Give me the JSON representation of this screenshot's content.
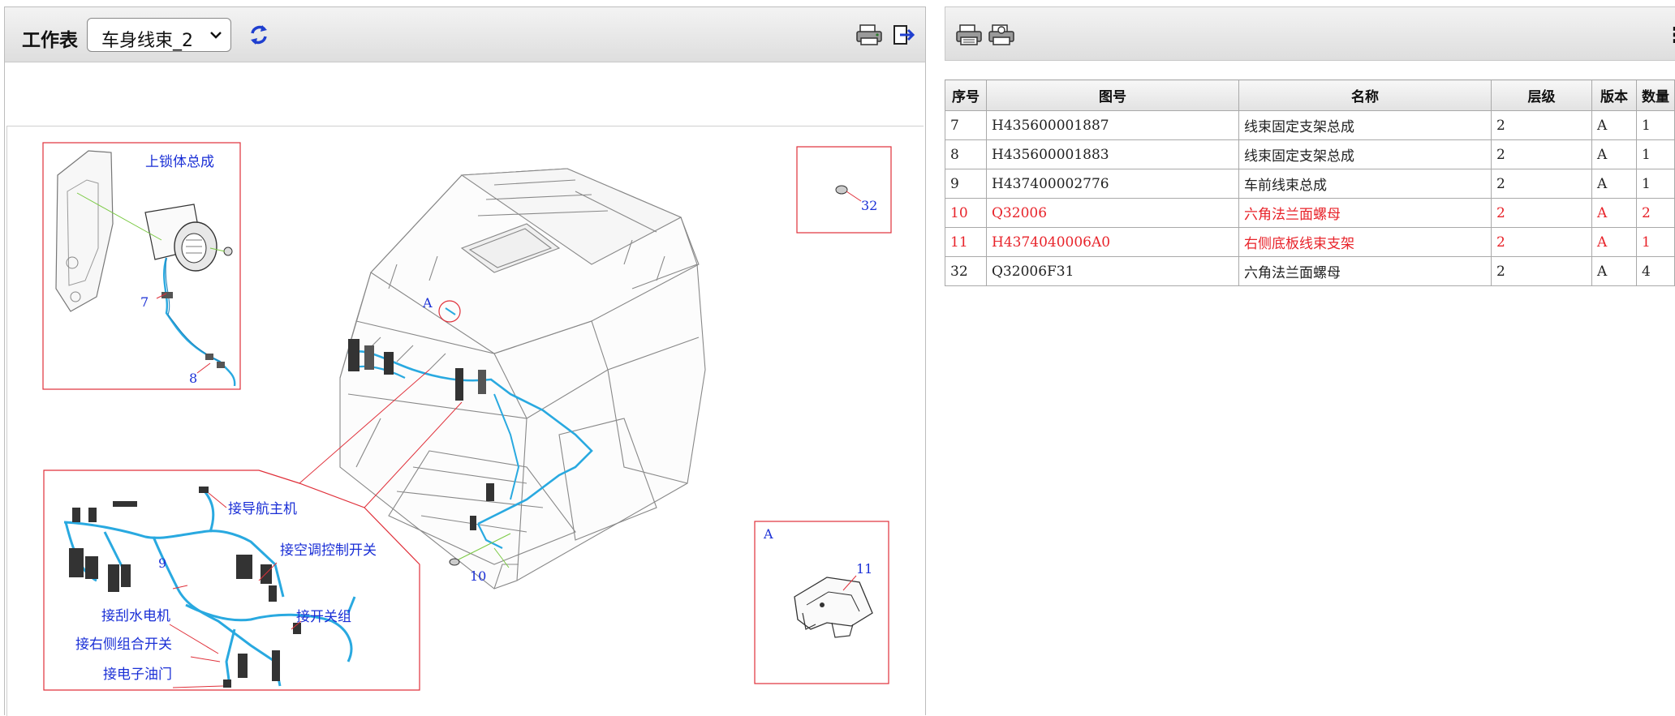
{
  "toolbar": {
    "worksheet_label": "工作表",
    "worksheet_selected": "车身线束_2"
  },
  "drawing": {
    "callouts": {
      "upper_lock": "上锁体总成",
      "nav": "接导航主机",
      "ac_switch": "接空调控制开关",
      "switch_group": "接开关组",
      "wiper": "接刮水电机",
      "right_combo": "接右侧组合开关",
      "throttle": "接电子油门"
    },
    "numbers": {
      "n7": "7",
      "n8": "8",
      "n9": "9",
      "n10": "10",
      "n11": "11",
      "n32": "32",
      "viewA_label": "A",
      "detailA_label": "A"
    }
  },
  "table": {
    "headers": {
      "seq": "序号",
      "part_no": "图号",
      "name": "名称",
      "level": "层级",
      "version": "版本",
      "qty": "数量"
    },
    "rows": [
      {
        "seq": "7",
        "part_no": "H435600001887",
        "name": "线束固定支架总成",
        "level": "2",
        "version": "A",
        "qty": "1",
        "highlight": false
      },
      {
        "seq": "8",
        "part_no": "H435600001883",
        "name": "线束固定支架总成",
        "level": "2",
        "version": "A",
        "qty": "1",
        "highlight": false
      },
      {
        "seq": "9",
        "part_no": "H437400002776",
        "name": "车前线束总成",
        "level": "2",
        "version": "A",
        "qty": "1",
        "highlight": false
      },
      {
        "seq": "10",
        "part_no": "Q32006",
        "name": "六角法兰面螺母",
        "level": "2",
        "version": "A",
        "qty": "2",
        "highlight": true
      },
      {
        "seq": "11",
        "part_no": "H4374040006A0",
        "name": "右侧底板线束支架",
        "level": "2",
        "version": "A",
        "qty": "1",
        "highlight": true
      },
      {
        "seq": "32",
        "part_no": "Q32006F31",
        "name": "六角法兰面螺母",
        "level": "2",
        "version": "A",
        "qty": "4",
        "highlight": false
      }
    ]
  },
  "colors": {
    "highlight_text": "#e8232a",
    "callout_text": "#1a2fd6",
    "harness": "#29a9e0",
    "frame_red": "#e0303a"
  },
  "icons": {
    "refresh": "refresh-icon",
    "print": "print-icon",
    "exit": "exit-icon",
    "printer_a": "printer-icon",
    "printer_b": "print-preview-icon"
  }
}
